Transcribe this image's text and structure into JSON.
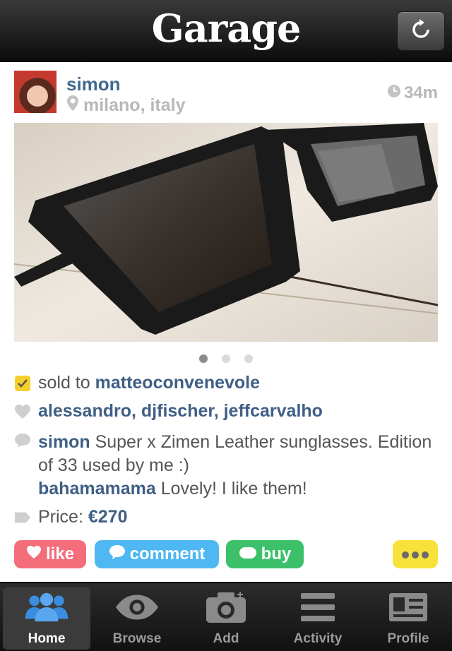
{
  "app": {
    "title": "Garage"
  },
  "post": {
    "username": "simon",
    "location": "milano, italy",
    "time": "34m",
    "photo_count": 3,
    "active_photo": 1,
    "sold_prefix": "sold to",
    "sold_to": "matteoconvenevole",
    "likes": "alessandro, djfischer, jeffcarvalho",
    "comments": [
      {
        "user": "simon",
        "text": "Super x Zimen Leather sunglasses. Edition of 33 used by me :)"
      },
      {
        "user": "bahamamama",
        "text": "Lovely! I like them!"
      }
    ],
    "price_label": "Price:",
    "price_value": "€270"
  },
  "actions": {
    "like": "like",
    "comment": "comment",
    "buy": "buy"
  },
  "colors": {
    "like": "#f46d7b",
    "comment": "#4fb8f2",
    "buy": "#3cc06a",
    "more": "#f8e23a",
    "link": "#3f5f85"
  },
  "tabs": [
    {
      "label": "Home",
      "icon": "people-icon",
      "active": true
    },
    {
      "label": "Browse",
      "icon": "eye-icon",
      "active": false
    },
    {
      "label": "Add",
      "icon": "camera-icon",
      "active": false
    },
    {
      "label": "Activity",
      "icon": "list-icon",
      "active": false
    },
    {
      "label": "Profile",
      "icon": "id-card-icon",
      "active": false
    }
  ]
}
